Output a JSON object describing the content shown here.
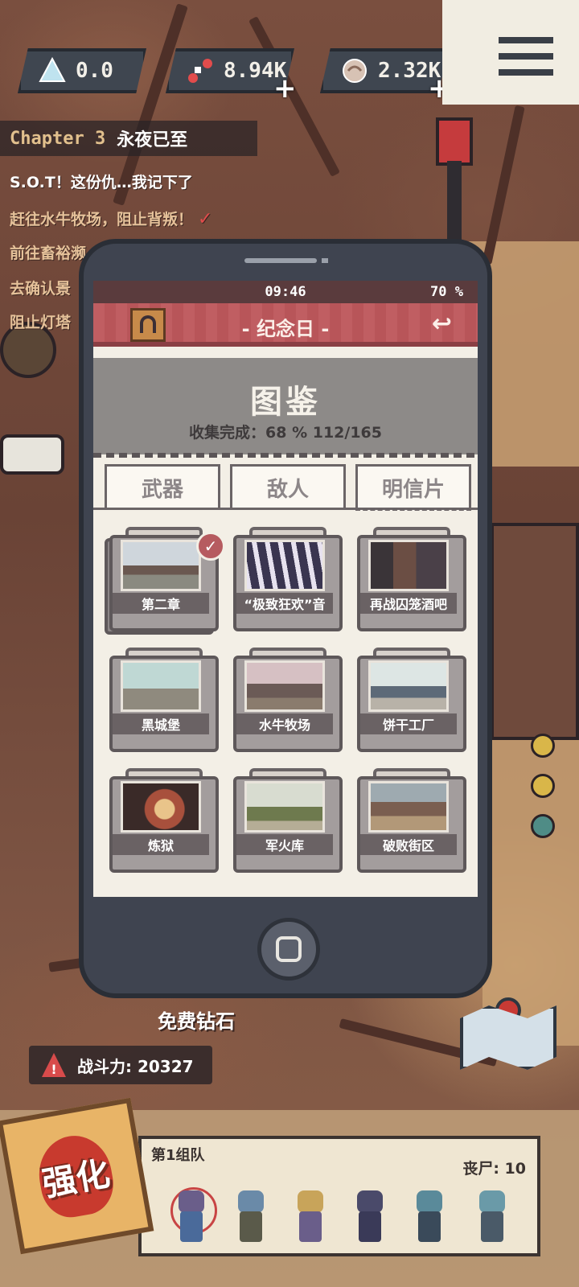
{
  "hud": {
    "gems": {
      "value": "0.0",
      "icon": "crystal-icon"
    },
    "resource1": {
      "value": "8.94K",
      "icon": "bone-icon",
      "plus": "+"
    },
    "resource2": {
      "value": "2.32K",
      "icon": "brain-icon",
      "plus": "+"
    },
    "menu_icon": "hamburger-menu-icon"
  },
  "chapter": {
    "number": "Chapter 3",
    "title": "永夜已至"
  },
  "quests": [
    {
      "text": "S.O.T！这份仇…我记下了"
    },
    {
      "text": "赶往水牛牧场，阻止背叛！",
      "done_mark": "✓"
    },
    {
      "text": "前往畜裕濒"
    },
    {
      "text": "去确认景"
    },
    {
      "text": "阻止灯塔"
    }
  ],
  "phone": {
    "time": "09:46",
    "battery": "70 %",
    "app_title": "- 纪念日 -",
    "back_icon": "back-arrow-icon",
    "avatar_icon": "headphones-icon",
    "banner_title": "图鉴",
    "progress_text": "收集完成：68 %  112/165",
    "collection_percent": 68,
    "collected": 112,
    "total": 165,
    "tabs": [
      {
        "label": "武器",
        "active": false
      },
      {
        "label": "敌人",
        "active": false
      },
      {
        "label": "明信片",
        "active": true
      }
    ],
    "cards": [
      {
        "label": "第二章",
        "checked": true,
        "check": "✓"
      },
      {
        "label": "“极致狂欢”音",
        "checked": false
      },
      {
        "label": "再战囚笼酒吧",
        "checked": false
      },
      {
        "label": "黑城堡",
        "checked": false
      },
      {
        "label": "水牛牧场",
        "checked": false
      },
      {
        "label": "饼干工厂",
        "checked": false
      },
      {
        "label": "炼狱",
        "checked": false
      },
      {
        "label": "军火库",
        "checked": false
      },
      {
        "label": "破败街区",
        "checked": false
      }
    ],
    "home_icon": "home-button-icon"
  },
  "bottom": {
    "free_diamond": "免费钻石",
    "power_label": "战斗力: 20327",
    "warn": "!",
    "upgrade_label": "强化",
    "squad_name": "第1组队",
    "zombie_count": "丧尸: 10",
    "map_icon": "map-icon"
  },
  "colors": {
    "title_bar": "#c05e62",
    "banner": "#8d8a88",
    "phone_body": "#3f4450",
    "accent_red": "#b65b60"
  }
}
